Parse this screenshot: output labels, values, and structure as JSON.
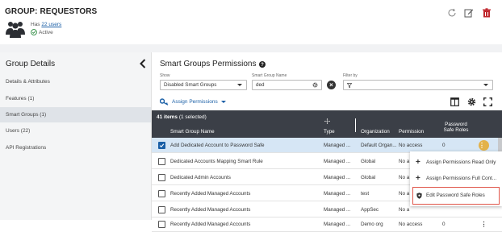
{
  "header": {
    "title": "GROUP: REQUESTORS",
    "has_prefix": "Has",
    "users_link": "22 users",
    "status": "Active"
  },
  "left_panel": {
    "title": "Group Details",
    "items": [
      {
        "label": "Details & Attributes"
      },
      {
        "label": "Features (1)"
      },
      {
        "label": "Smart Groups (1)"
      },
      {
        "label": "Users (22)"
      },
      {
        "label": "API Registrations"
      }
    ]
  },
  "main": {
    "title": "Smart Groups Permissions",
    "show_label": "Show",
    "show_value": "Disabled Smart Groups",
    "name_label": "Smart Group Name",
    "name_value": "ded",
    "filter_label": "Filter by",
    "assign_label": "Assign Permissions",
    "table": {
      "count_bold": "41 items",
      "count_rest": "(1 selected)",
      "headers": {
        "name": "Smart Group Name",
        "type": "Type",
        "org": "Organization",
        "permission": "Permission",
        "psr_line1": "Password",
        "psr_line2": "Safe Roles"
      },
      "rows": [
        {
          "name": "Add Dedicated Account to Password Safe",
          "type": "Managed ...",
          "org": "Default Organ...",
          "permission": "No access",
          "psr": "0",
          "selected": true
        },
        {
          "name": "Dedicated Accounts Mapping Smart Rule",
          "type": "Managed ...",
          "org": "Global",
          "permission": "No a",
          "psr": ""
        },
        {
          "name": "Dedicated Admin Accounts",
          "type": "Managed ...",
          "org": "Global",
          "permission": "No a",
          "psr": ""
        },
        {
          "name": "Recently Added Managed Accounts",
          "type": "Managed ...",
          "org": "test",
          "permission": "No a",
          "psr": ""
        },
        {
          "name": "Recently Added Managed Accounts",
          "type": "Managed ...",
          "org": "AppSec",
          "permission": "No a",
          "psr": ""
        },
        {
          "name": "Recently Added Managed Accounts",
          "type": "Managed ...",
          "org": "Demo org",
          "permission": "No access",
          "psr": "0"
        }
      ]
    },
    "menu": {
      "items": [
        {
          "label": "Assign Permissions Read Only"
        },
        {
          "label": "Assign Permissions Full Cont..."
        },
        {
          "label": "Edit Password Safe Roles"
        }
      ]
    }
  },
  "colors": {
    "accent": "#1a5fa6",
    "header_bg": "#3b3f47",
    "selected_row": "#d6e6f5",
    "kebab_active": "#e3b24a",
    "danger": "#c0272d",
    "highlight_outline": "#e0564a"
  },
  "icons": {
    "group": "users-group-icon",
    "active": "check-circle-icon",
    "refresh": "refresh-icon",
    "edit": "edit-icon",
    "delete": "trash-icon",
    "back": "chevron-left-icon",
    "help": "help-icon",
    "key": "key-icon",
    "columns": "columns-icon",
    "settings": "gear-icon",
    "fullscreen": "fullscreen-icon",
    "move": "move-icon",
    "clear": "clear-icon",
    "filter": "filter-icon",
    "plus": "plus-icon",
    "shield": "shield-icon",
    "kebab": "kebab-icon"
  }
}
